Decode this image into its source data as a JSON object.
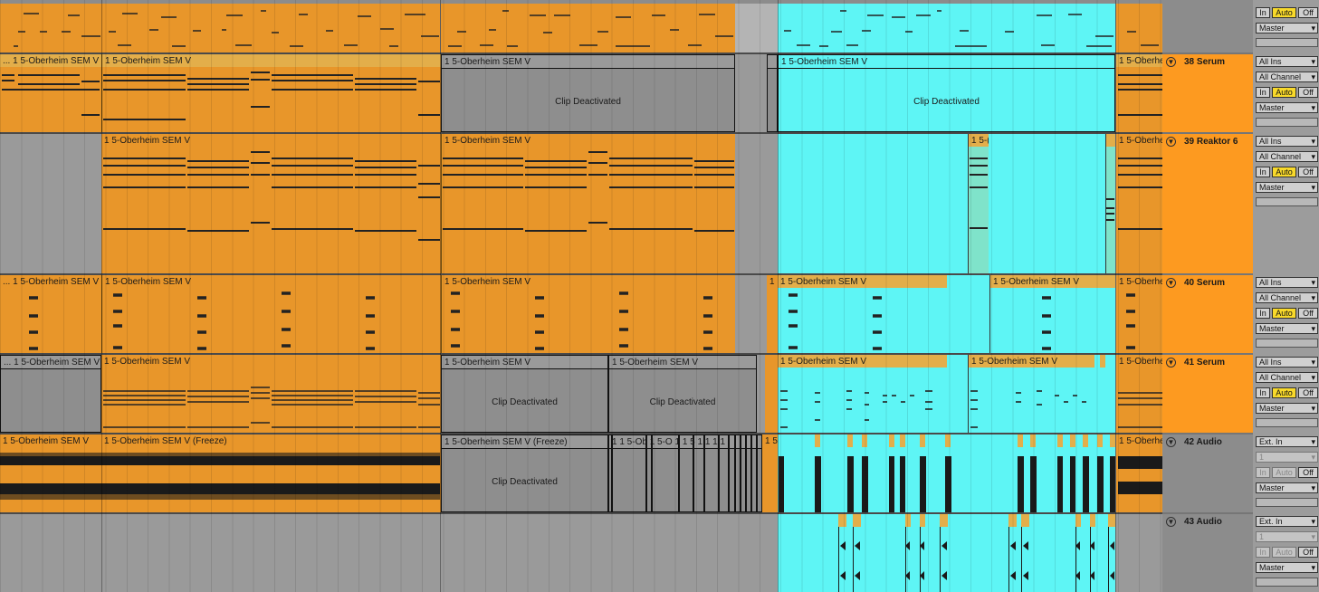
{
  "clip_name": "1 5-Oberheim SEM V",
  "clip_name_freeze": "1 5-Oberheim SEM V (Freeze)",
  "clip_name_trunc": "... 1 5-Oberheim SEM V",
  "clip_short": "1 5-Oberhe",
  "clip_deactivated": "Clip Deactivated",
  "tracks": [
    {
      "id": "38",
      "name": "38 Serum",
      "input_type": "All Ins",
      "input_channel": "All Channel",
      "monitor": [
        "In",
        "Auto",
        "Off"
      ],
      "output": "Master"
    },
    {
      "id": "39",
      "name": "39 Reaktor 6",
      "input_type": "All Ins",
      "input_channel": "All Channel",
      "monitor": [
        "In",
        "Auto",
        "Off"
      ],
      "output": "Master"
    },
    {
      "id": "40",
      "name": "40 Serum",
      "input_type": "All Ins",
      "input_channel": "All Channel",
      "monitor": [
        "In",
        "Auto",
        "Off"
      ],
      "output": "Master"
    },
    {
      "id": "41",
      "name": "41 Serum",
      "input_type": "All Ins",
      "input_channel": "All Channel",
      "monitor": [
        "In",
        "Auto",
        "Off"
      ],
      "output": "Master"
    },
    {
      "id": "42",
      "name": "42 Audio",
      "input_type": "Ext. In",
      "input_channel": "1",
      "monitor": [
        "In",
        "Auto",
        "Off"
      ],
      "output": "Master"
    },
    {
      "id": "43",
      "name": "43 Audio",
      "input_type": "Ext. In",
      "input_channel": "1",
      "monitor": [
        "In",
        "Auto",
        "Off"
      ],
      "output": "Master"
    }
  ],
  "top_track": {
    "monitor": [
      "In",
      "Auto",
      "Off"
    ],
    "output": "Master"
  },
  "colors": {
    "clip_orange": "#e8962a",
    "track_orange": "#fd9a20",
    "selection_cyan": "#5ef5f5",
    "deactivated_grey": "#8e8e8e",
    "auto_yellow": "#f8d92a"
  },
  "icons": {
    "fold": "fold-triangle-icon",
    "dropdown": "chevron-down-icon"
  }
}
